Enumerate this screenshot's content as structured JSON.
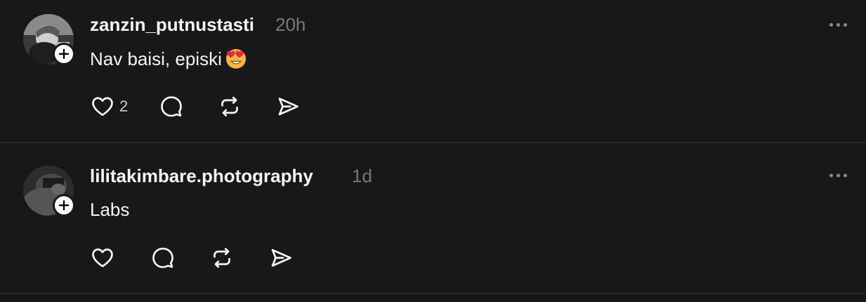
{
  "posts": [
    {
      "username": "zanzin_putnustasti",
      "time": "20h",
      "text": "Nav baisi, episki",
      "emoji": "😍",
      "likes": "2"
    },
    {
      "username": "lilitakimbare.photography",
      "time": "1d",
      "text": "Labs",
      "likes": ""
    }
  ],
  "icons": {
    "like": "heart-icon",
    "reply": "comment-icon",
    "repost": "repost-icon",
    "share": "send-icon",
    "more": "more-icon",
    "follow": "plus-icon"
  },
  "colors": {
    "background": "#181818",
    "text": "#f3f5f7",
    "muted": "#777777",
    "divider": "#333638"
  }
}
